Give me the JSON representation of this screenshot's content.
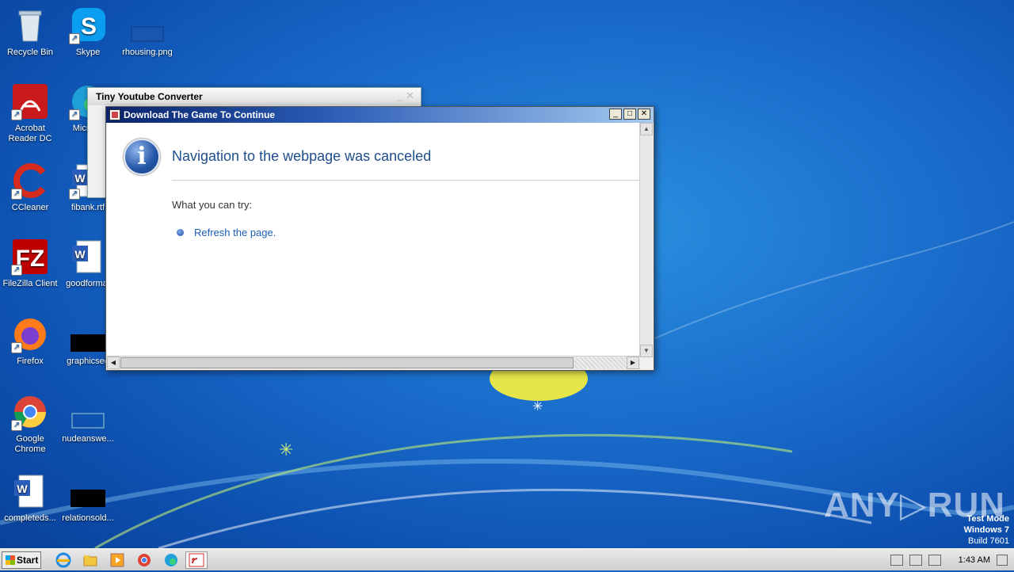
{
  "desktop": {
    "icons": [
      {
        "label": "Recycle Bin",
        "icon": "recycle-bin-icon"
      },
      {
        "label": "Skype",
        "icon": "skype-icon"
      },
      {
        "label": "rhousing.png",
        "icon": "image-file-icon"
      },
      {
        "label": "Acrobat Reader DC",
        "icon": "acrobat-icon"
      },
      {
        "label": "Microso",
        "icon": "edge-icon"
      },
      {
        "label": "CCleaner",
        "icon": "ccleaner-icon"
      },
      {
        "label": "fibank.rtf",
        "icon": "word-doc-icon"
      },
      {
        "label": "FileZilla Client",
        "icon": "filezilla-icon"
      },
      {
        "label": "goodformat",
        "icon": "word-doc-icon"
      },
      {
        "label": "Firefox",
        "icon": "firefox-icon"
      },
      {
        "label": "graphicsed",
        "icon": "black-file-icon"
      },
      {
        "label": "Google Chrome",
        "icon": "chrome-icon"
      },
      {
        "label": "nudeanswe...",
        "icon": "blank-file-icon"
      },
      {
        "label": "completeds...",
        "icon": "word-doc-icon"
      },
      {
        "label": "relationsold...",
        "icon": "black-file-icon"
      }
    ]
  },
  "background_window": {
    "title": "Tiny Youtube Converter"
  },
  "dialog": {
    "title": "Download The Game To Continue",
    "heading": "Navigation to the webpage was canceled",
    "subhead": "What you can try:",
    "link": "Refresh the page.",
    "buttons": {
      "minimize": "_",
      "maximize": "□",
      "close": "✕"
    }
  },
  "watermark": {
    "brand": "ANY▷RUN",
    "line1": "Test Mode",
    "line2": "Windows 7",
    "line3": "Build 7601"
  },
  "taskbar": {
    "start_label": "Start",
    "pinned": [
      "internet-explorer-icon",
      "explorer-icon",
      "media-player-icon",
      "chrome-icon",
      "edge-icon",
      "rss-app-icon"
    ],
    "clock": "1:43 AM"
  }
}
